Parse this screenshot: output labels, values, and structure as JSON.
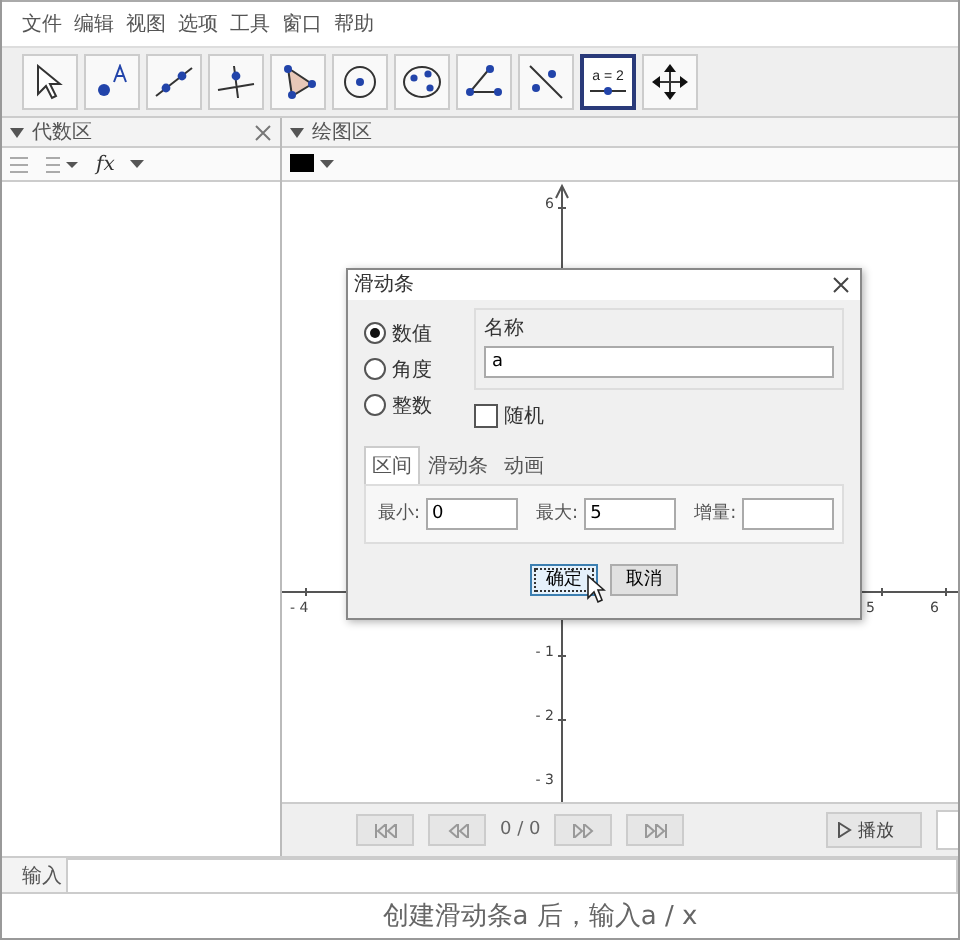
{
  "menu": [
    "文件",
    "编辑",
    "视图",
    "选项",
    "工具",
    "窗口",
    "帮助"
  ],
  "tools": [
    {
      "kind": "cursor",
      "selected": false
    },
    {
      "kind": "point",
      "selected": false
    },
    {
      "kind": "line",
      "selected": false
    },
    {
      "kind": "perpendicular",
      "selected": false
    },
    {
      "kind": "triangle",
      "selected": false
    },
    {
      "kind": "circle",
      "selected": false
    },
    {
      "kind": "ellipse",
      "selected": false
    },
    {
      "kind": "angle",
      "selected": false
    },
    {
      "kind": "reflect",
      "selected": false
    },
    {
      "kind": "slider",
      "label": "a = 2",
      "selected": true
    },
    {
      "kind": "move",
      "selected": false
    }
  ],
  "algebra_panel": {
    "title": "代数区",
    "function_menu": "fx"
  },
  "graphics_panel": {
    "title": "绘图区"
  },
  "axes": {
    "x_tick_labels": [
      "- 4",
      "5",
      "6"
    ],
    "y_tick_labels": [
      "6",
      "- 1",
      "- 2",
      "- 3"
    ]
  },
  "dialog": {
    "title": "滑动条",
    "types": [
      {
        "label": "数值",
        "selected": true
      },
      {
        "label": "角度",
        "selected": false
      },
      {
        "label": "整数",
        "selected": false
      }
    ],
    "name_label": "名称",
    "name_value": "a",
    "random": {
      "label": "随机",
      "checked": false
    },
    "tabs": [
      {
        "label": "区间",
        "selected": true
      },
      {
        "label": "滑动条",
        "selected": false
      },
      {
        "label": "动画",
        "selected": false
      }
    ],
    "fields": [
      {
        "label": "最小:",
        "value": "0"
      },
      {
        "label": "最大:",
        "value": "5"
      },
      {
        "label": "增量:"
      }
    ],
    "buttons": [
      {
        "label": "确定",
        "focused": true
      },
      {
        "label": "取消",
        "focused": false
      }
    ]
  },
  "playback": {
    "counter": "0 / 0",
    "play": "播放"
  },
  "input_bar": {
    "label": "输入"
  },
  "caption": "创建滑动条a 后，输入a / x"
}
